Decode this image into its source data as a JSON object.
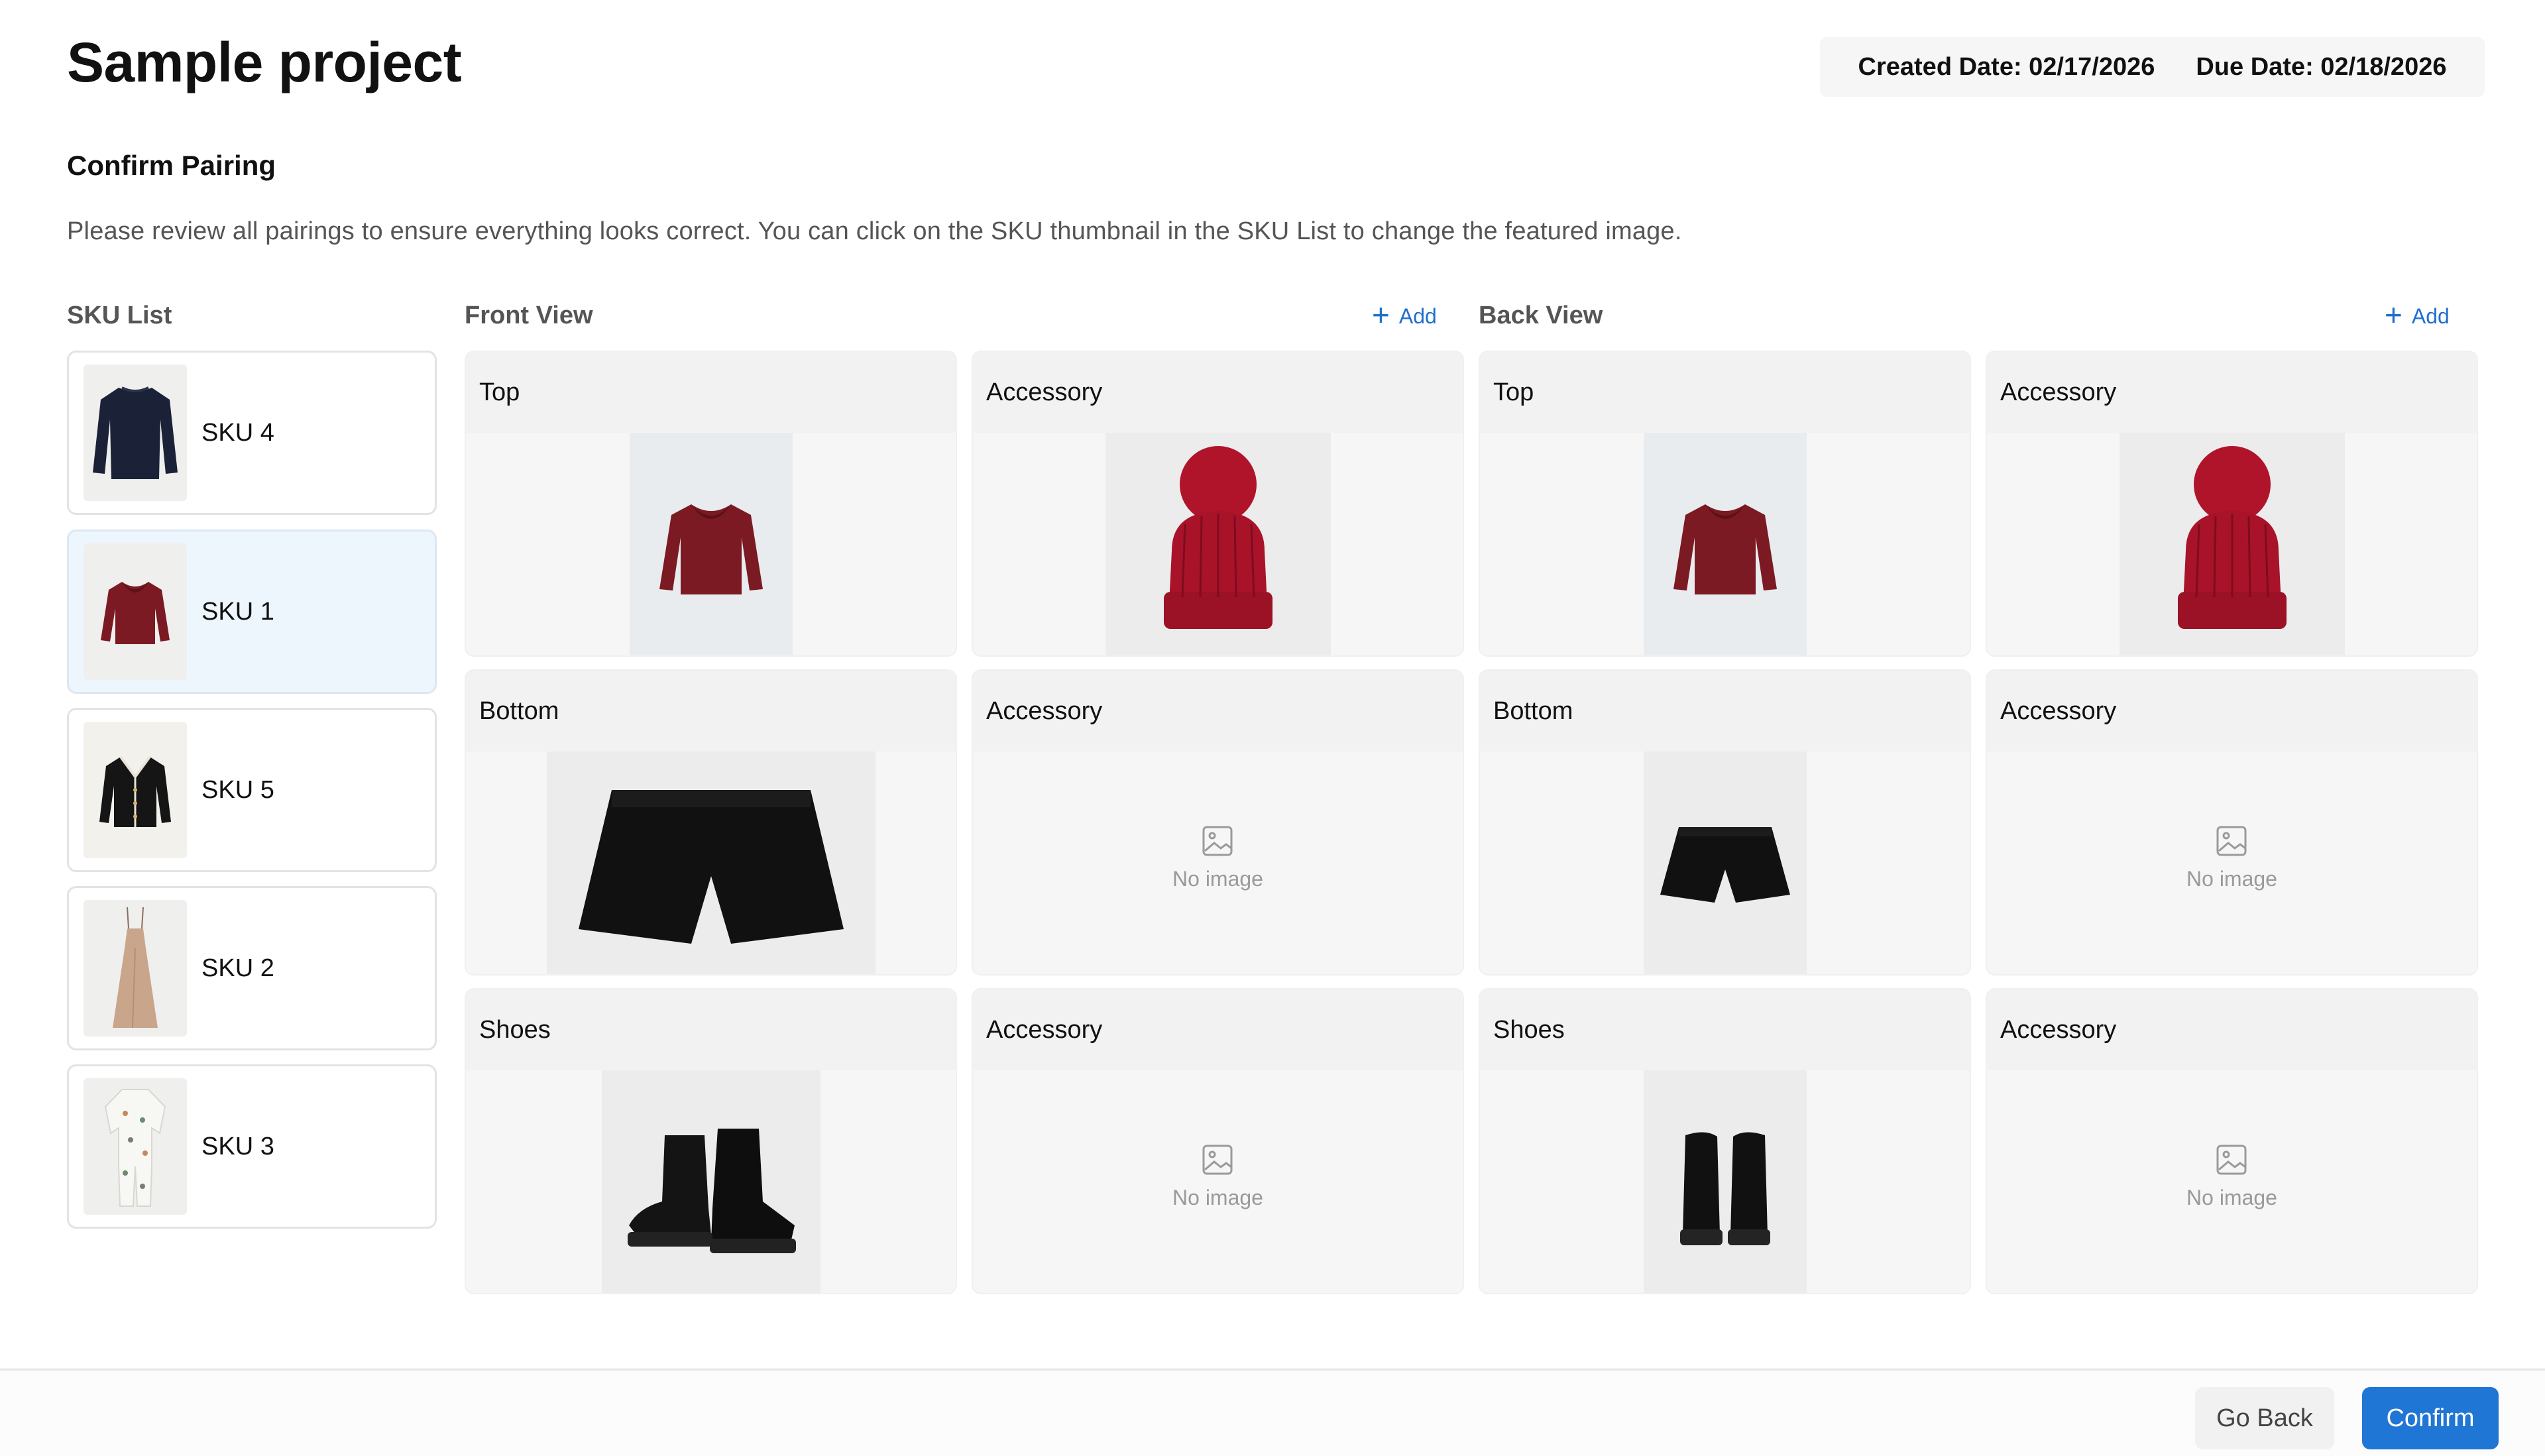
{
  "header": {
    "title": "Sample project",
    "created_date": "Created Date: 02/17/2026",
    "due_date": "Due Date: 02/18/2026"
  },
  "section": {
    "title": "Confirm Pairing",
    "instructions": "Please review all pairings to ensure everything looks correct. You can click on the SKU thumbnail in the SKU List to change the featured image."
  },
  "sku_list": {
    "label": "SKU List",
    "items": [
      {
        "label": "SKU 4",
        "image": "navy-sweater"
      },
      {
        "label": "SKU 1",
        "image": "red-ruffle-sweater",
        "selected": true
      },
      {
        "label": "SKU 5",
        "image": "black-cardigan"
      },
      {
        "label": "SKU 2",
        "image": "beige-slip-dress"
      },
      {
        "label": "SKU 3",
        "image": "printed-baby-sleeper"
      }
    ]
  },
  "front_view": {
    "label": "Front View",
    "add_label": "Add",
    "slots": [
      {
        "label": "Top",
        "image": "red-ruffle-sweater"
      },
      {
        "label": "Accessory",
        "image": "red-pompom-beanie"
      },
      {
        "label": "Bottom",
        "image": "black-shorts"
      },
      {
        "label": "Accessory",
        "image": null,
        "empty_text": "No image"
      },
      {
        "label": "Shoes",
        "image": "black-combat-boots"
      },
      {
        "label": "Accessory",
        "image": null,
        "empty_text": "No image"
      }
    ]
  },
  "back_view": {
    "label": "Back View",
    "add_label": "Add",
    "slots": [
      {
        "label": "Top",
        "image": "red-ruffle-sweater"
      },
      {
        "label": "Accessory",
        "image": "red-pompom-beanie"
      },
      {
        "label": "Bottom",
        "image": "black-shorts"
      },
      {
        "label": "Accessory",
        "image": null,
        "empty_text": "No image"
      },
      {
        "label": "Shoes",
        "image": "black-boots-back"
      },
      {
        "label": "Accessory",
        "image": null,
        "empty_text": "No image"
      }
    ]
  },
  "footer": {
    "go_back_label": "Go Back",
    "confirm_label": "Confirm"
  },
  "colors": {
    "accent": "#2076d4",
    "selected_bg": "#eef6fd"
  }
}
